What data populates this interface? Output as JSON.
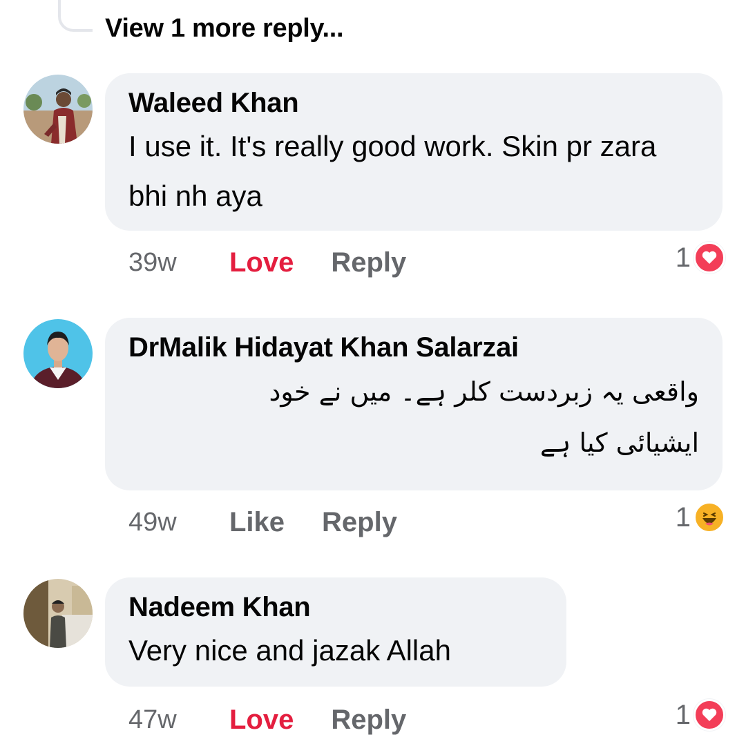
{
  "thread": {
    "view_more_label": "View 1 more reply..."
  },
  "comments": [
    {
      "author": "Waleed Khan",
      "text": "I use it. It's really good work. Skin pr zara bhi nh aya",
      "time": "39w",
      "primary_action": "Love",
      "primary_action_active": true,
      "reply_label": "Reply",
      "reaction_count": "1",
      "reaction_icon": "love-icon"
    },
    {
      "author": "DrMalik Hidayat Khan Salarzai",
      "text": "واقعی یہ زبردست کلر ہے۔ میں نے خود ایشیائی کیا ہے",
      "time": "49w",
      "primary_action": "Like",
      "primary_action_active": false,
      "reply_label": "Reply",
      "reaction_count": "1",
      "reaction_icon": "haha-icon"
    },
    {
      "author": "Nadeem Khan",
      "text": "Very nice and jazak Allah",
      "time": "47w",
      "primary_action": "Love",
      "primary_action_active": true,
      "reply_label": "Reply",
      "reaction_count": "1",
      "reaction_icon": "love-icon"
    }
  ],
  "colors": {
    "bubble": "#f0f2f5",
    "love_red": "#e41e3f",
    "secondary_text": "#65676b",
    "haha_yellow": "#f7b125"
  }
}
